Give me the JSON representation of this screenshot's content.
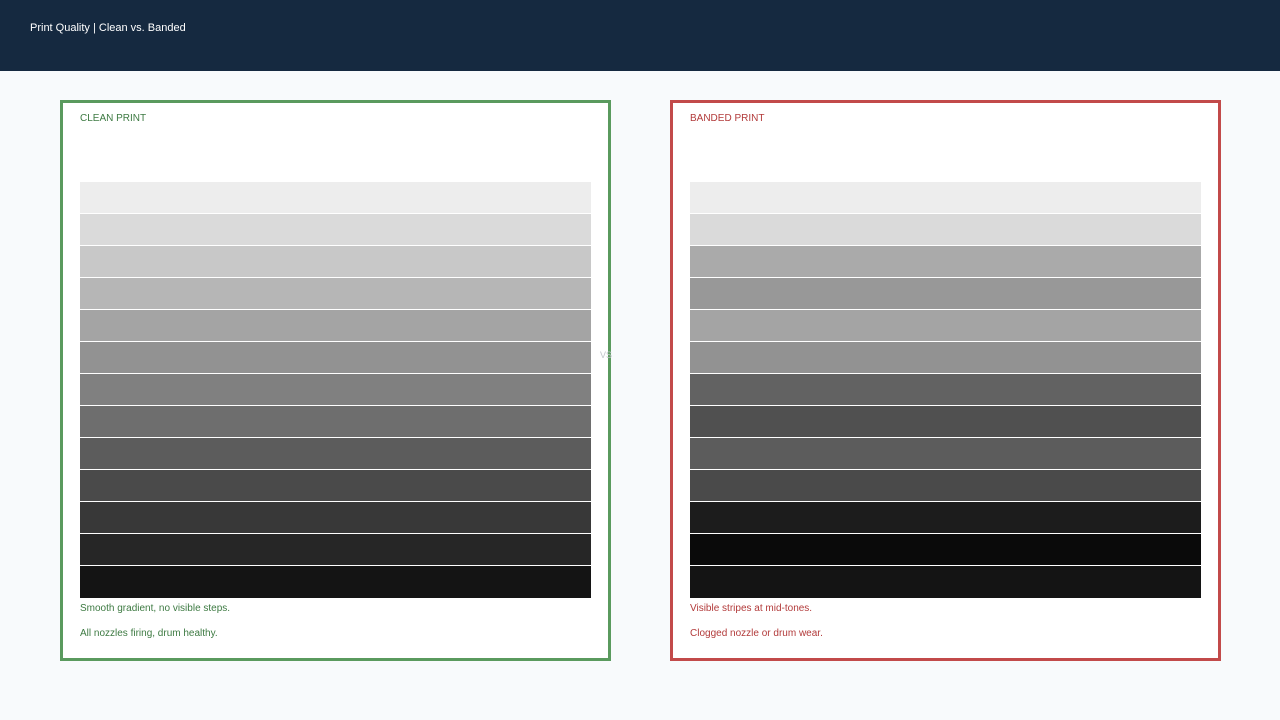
{
  "header": {
    "title": "Print Quality | Clean vs. Banded"
  },
  "divider_label": "VS",
  "panels": {
    "clean": {
      "title": "CLEAN PRINT",
      "caption_1": "Smooth gradient, no visible steps.",
      "caption_2": "All nozzles firing, drum healthy.",
      "accent_color": "#5a9a5e",
      "bands": [
        "#ededed",
        "#dadada",
        "#c8c8c8",
        "#b6b6b6",
        "#a4a4a4",
        "#929292",
        "#808080",
        "#6e6e6e",
        "#5c5c5c",
        "#4a4a4a",
        "#383838",
        "#262626",
        "#141414"
      ]
    },
    "banded": {
      "title": "BANDED PRINT",
      "caption_1": "Visible stripes at mid-tones.",
      "caption_2": "Clogged nozzle or drum wear.",
      "accent_color": "#c24a4a",
      "bands": [
        "#ededed",
        "#dadada",
        "#aaaaaa",
        "#989898",
        "#a4a4a4",
        "#929292",
        "#626262",
        "#505050",
        "#5c5c5c",
        "#4a4a4a",
        "#1c1c1c",
        "#0a0a0a",
        "#141414"
      ]
    }
  }
}
